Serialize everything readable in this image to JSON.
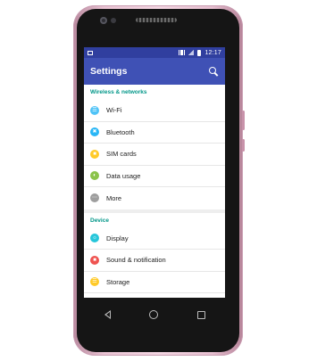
{
  "status_bar": {
    "time": "12:17"
  },
  "app_bar": {
    "title": "Settings",
    "search_icon": "search-icon"
  },
  "sections": [
    {
      "header": "Wireless & networks",
      "items": [
        {
          "label": "Wi-Fi",
          "icon": "wifi-icon",
          "color": "#4fc3f7"
        },
        {
          "label": "Bluetooth",
          "icon": "bluetooth-icon",
          "color": "#29b6f6"
        },
        {
          "label": "SIM cards",
          "icon": "sim-icon",
          "color": "#ffca28"
        },
        {
          "label": "Data usage",
          "icon": "data-usage-icon",
          "color": "#8bc34a"
        },
        {
          "label": "More",
          "icon": "more-icon",
          "color": "#9e9e9e"
        }
      ]
    },
    {
      "header": "Device",
      "items": [
        {
          "label": "Display",
          "icon": "display-icon",
          "color": "#26c6da"
        },
        {
          "label": "Sound & notification",
          "icon": "sound-icon",
          "color": "#ef5350"
        },
        {
          "label": "Storage",
          "icon": "storage-icon",
          "color": "#ffca28"
        }
      ]
    }
  ],
  "colors": {
    "status_bar": "#303f9f",
    "app_bar": "#3f51b5",
    "section_header": "#009688",
    "phone_body": "#e9c3d3"
  },
  "nav_bar": {
    "back_icon": "back-icon",
    "home_icon": "home-icon",
    "recents_icon": "recents-icon"
  }
}
